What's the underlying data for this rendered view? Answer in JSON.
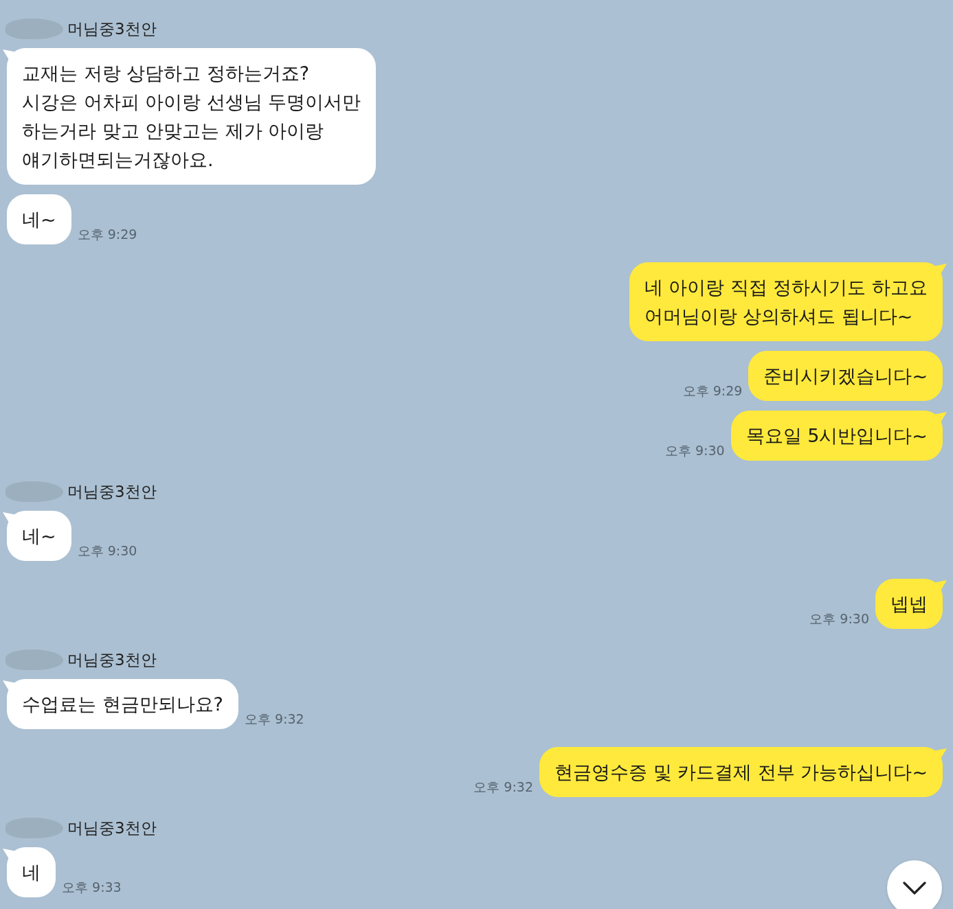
{
  "chat": {
    "groups": [
      {
        "kind": "received",
        "sender": {
          "name": "머님중3천안",
          "redacted": true
        },
        "messages": [
          {
            "text": "교재는 저랑 상담하고 정하는거죠?\n시강은 어차피 아이랑 선생님 두명이서만\n하는거라 맞고 안맞고는 제가 아이랑\n얘기하면되는거잖아요.",
            "tail": true
          },
          {
            "text": "네~",
            "tail": false,
            "time": "오후 9:29"
          }
        ]
      },
      {
        "kind": "sent",
        "messages": [
          {
            "text": "네 아이랑 직접 정하시기도 하고요\n어머님이랑 상의하셔도 됩니다~",
            "tail": true
          },
          {
            "text": "준비시키겠습니다~",
            "tail": false,
            "time": "오후 9:29"
          },
          {
            "text": "목요일 5시반입니다~",
            "tail": true,
            "time": "오후 9:30"
          }
        ]
      },
      {
        "kind": "received",
        "sender": {
          "name": "머님중3천안",
          "redacted": true
        },
        "messages": [
          {
            "text": "네~",
            "tail": true,
            "time": "오후 9:30"
          }
        ]
      },
      {
        "kind": "sent",
        "messages": [
          {
            "text": "넵넵",
            "tail": true,
            "time": "오후 9:30"
          }
        ]
      },
      {
        "kind": "received",
        "sender": {
          "name": "머님중3천안",
          "redacted": true
        },
        "messages": [
          {
            "text": "수업료는 현금만되나요?",
            "tail": true,
            "time": "오후 9:32"
          }
        ]
      },
      {
        "kind": "sent",
        "messages": [
          {
            "text": "현금영수증 및 카드결제 전부 가능하십니다~",
            "tail": true,
            "time": "오후 9:32"
          }
        ]
      },
      {
        "kind": "received",
        "sender": {
          "name": "머님중3천안",
          "redacted": true
        },
        "messages": [
          {
            "text": "네",
            "tail": true,
            "time": "오후 9:33"
          }
        ]
      }
    ]
  }
}
